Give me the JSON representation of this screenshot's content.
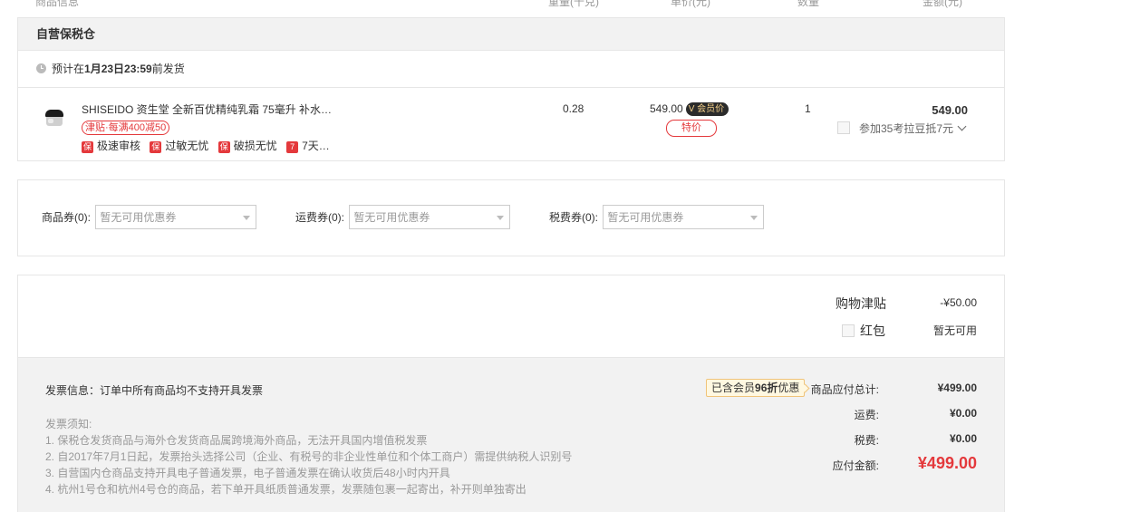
{
  "table_header": {
    "product_info": "商品信息",
    "weight": "重量(千克)",
    "unit_price": "单价(元)",
    "quantity": "数量",
    "amount": "金额(元)"
  },
  "warehouse": {
    "name": "自营保税仓",
    "ship_prefix": "预计在",
    "ship_date": "1月23日23:59",
    "ship_suffix": "前发货"
  },
  "product": {
    "title": "SHISEIDO 资生堂 全新百优精纯乳霜 75毫升 补水…",
    "promo": "津贴·每满400减50",
    "tags": [
      {
        "icon": "保",
        "label": "极速审核"
      },
      {
        "icon": "保",
        "label": "过敏无忧"
      },
      {
        "icon": "保",
        "label": "破损无忧"
      },
      {
        "icon": "7",
        "label": "7天…"
      }
    ],
    "weight": "0.28",
    "price": "549.00",
    "vip_badge": "会员价",
    "special_tag": "特价",
    "quantity": "1",
    "amount": "549.00",
    "bean_offer": "参加35考拉豆抵7元"
  },
  "coupons": [
    {
      "label": "商品券(0):",
      "placeholder": "暂无可用优惠券"
    },
    {
      "label": "运费券(0):",
      "placeholder": "暂无可用优惠券"
    },
    {
      "label": "税费券(0):",
      "placeholder": "暂无可用优惠券"
    }
  ],
  "summary": {
    "allowance_label": "购物津贴",
    "allowance_value": "-¥50.00",
    "redpacket_label": "红包",
    "redpacket_value": "暂无可用",
    "invoice_info": "发票信息：订单中所有商品均不支持开具发票",
    "invoice_notes_title": "发票须知:",
    "invoice_notes": [
      "1. 保税仓发货商品与海外仓发货商品属跨境海外商品，无法开具国内增值税发票",
      "2. 自2017年7月1日起，发票抬头选择公司（企业、有税号的非企业性单位和个体工商户）需提供纳税人识别号",
      "3. 自营国内仓商品支持开具电子普通发票，电子普通发票在确认收货后48小时内开具",
      "4. 杭州1号仓和杭州4号仓的商品，若下单开具纸质普通发票，发票随包裹一起寄出，补开则单独寄出"
    ],
    "vip_discount_prefix": "已含会员",
    "vip_discount_bold": "96折",
    "vip_discount_suffix": "优惠",
    "goods_total_label": "商品应付总计:",
    "goods_total_value": "¥499.00",
    "shipping_label": "运费:",
    "shipping_value": "¥0.00",
    "tax_label": "税费:",
    "tax_value": "¥0.00",
    "payable_label": "应付金额:",
    "payable_value": "¥499.00"
  },
  "colors": {
    "accent_red": "#e4393c",
    "header_gray": "#f2f2f2",
    "border_gray": "#e6e6e6"
  }
}
